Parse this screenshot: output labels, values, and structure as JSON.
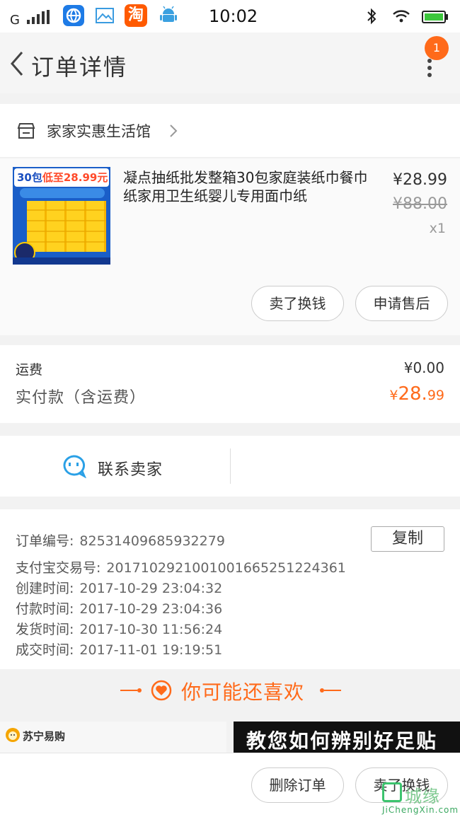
{
  "status_bar": {
    "carrier": "G",
    "time": "10:02",
    "taobao_char": "淘"
  },
  "header": {
    "title": "订单详情",
    "badge_count": "1"
  },
  "shop": {
    "name": "家家实惠生活馆"
  },
  "product": {
    "title": "凝点抽纸批发整箱30包家庭装纸巾餐巾纸家用卫生纸婴儿专用面巾纸",
    "price": "¥28.99",
    "original_price": "¥88.00",
    "quantity": "x1",
    "thumb_banner_prefix": "30包",
    "thumb_banner_highlight": "低至28.99元",
    "buttons": {
      "sell": "卖了换钱",
      "after_sale": "申请售后"
    }
  },
  "fees": {
    "shipping_label": "运费",
    "shipping_value": "¥0.00",
    "paid_label": "实付款（含运费）",
    "paid_currency": "¥",
    "paid_integer": "28.",
    "paid_decimal": "99"
  },
  "contact": {
    "label": "联系卖家"
  },
  "order_info": {
    "copy_label": "复制",
    "rows": [
      {
        "key": "订单编号:",
        "value": "82531409685932279"
      },
      {
        "key": "支付宝交易号:",
        "value": "2017102921001001665251224361"
      },
      {
        "key": "创建时间:",
        "value": "2017-10-29 23:04:32"
      },
      {
        "key": "付款时间:",
        "value": "2017-10-29 23:04:36"
      },
      {
        "key": "发货时间:",
        "value": "2017-10-30 11:56:24"
      },
      {
        "key": "成交时间:",
        "value": "2017-11-01 19:19:51"
      }
    ]
  },
  "recommend": {
    "title": "你可能还喜欢",
    "left_brand": "苏宁易购",
    "right_banner": "教您如何辨别好足贴"
  },
  "bottom_bar": {
    "delete": "删除订单",
    "sell": "卖了换钱"
  },
  "watermark": {
    "text": "城缘",
    "url": "JiChengXin.com"
  },
  "colors": {
    "accent": "#ff6a1a",
    "background": "#f2f2f2"
  }
}
